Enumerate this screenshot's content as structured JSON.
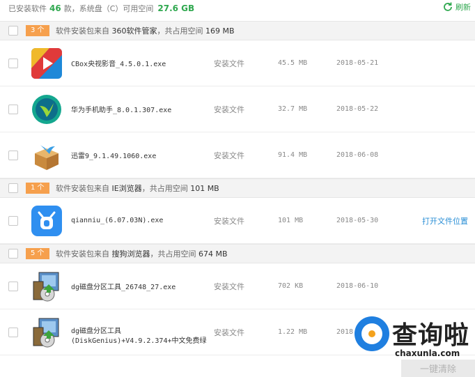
{
  "summary": {
    "prefix": "已安装软件",
    "count": "46",
    "mid": "款，系统盘（C）可用空间",
    "free": "27.6 GB"
  },
  "refresh_label": "刷新",
  "groups": [
    {
      "badge": "3 个",
      "text_prefix": "软件安装包来自",
      "source": "360软件管家",
      "text_mid": "，共占用空间",
      "size": "169 MB",
      "items": [
        {
          "name": "CBox央视影音_4.5.0.1.exe",
          "type": "安装文件",
          "size": "45.5 MB",
          "date": "2018-05-21",
          "link": ""
        },
        {
          "name": "华为手机助手_8.0.1.307.exe",
          "type": "安装文件",
          "size": "32.7 MB",
          "date": "2018-05-22",
          "link": ""
        },
        {
          "name": "迅雷9_9.1.49.1060.exe",
          "type": "安装文件",
          "size": "91.4 MB",
          "date": "2018-06-08",
          "link": ""
        }
      ]
    },
    {
      "badge": "1 个",
      "text_prefix": "软件安装包来自",
      "source": "IE浏览器",
      "text_mid": "，共占用空间",
      "size": "101 MB",
      "items": [
        {
          "name": "qianniu_(6.07.03N).exe",
          "type": "安装文件",
          "size": "101 MB",
          "date": "2018-05-30",
          "link": "打开文件位置"
        }
      ]
    },
    {
      "badge": "5 个",
      "text_prefix": "软件安装包来自",
      "source": "搜狗浏览器",
      "text_mid": "，共占用空间",
      "size": "674 MB",
      "items": [
        {
          "name": "dg磁盘分区工具_26748_27.exe",
          "type": "安装文件",
          "size": "702 KB",
          "date": "2018-06-10",
          "link": ""
        },
        {
          "name": "dg磁盘分区工具",
          "name2": "(DiskGenius)+V4.9.2.374+中文免费绿",
          "type": "安装文件",
          "size": "1.22 MB",
          "date": "2018",
          "link": ""
        }
      ]
    }
  ],
  "clean_button": "一键清除",
  "watermark": {
    "text": "查询啦",
    "sub": "chaxunla.com"
  },
  "colors": {
    "accent_green": "#2fa84f",
    "badge_orange": "#f6a04d",
    "link_blue": "#2b8fd6"
  }
}
